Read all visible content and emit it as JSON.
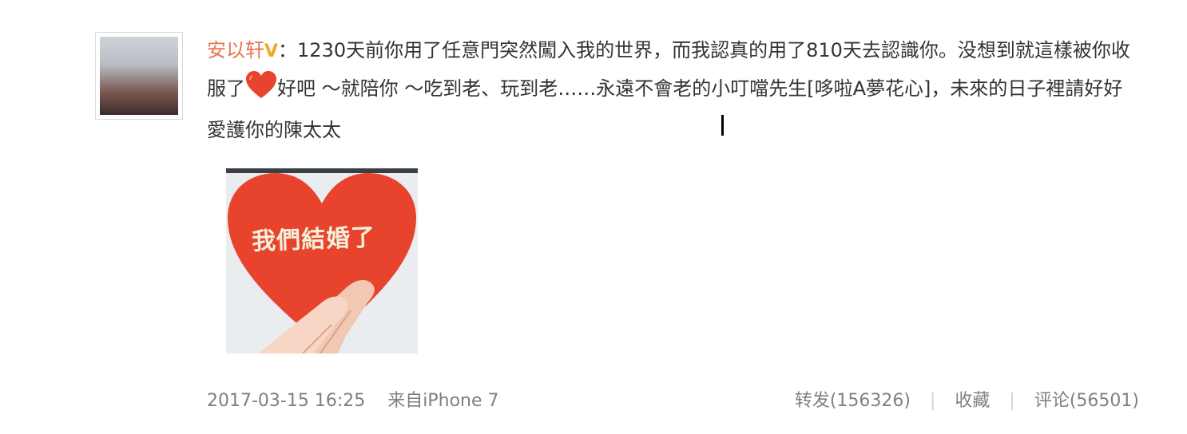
{
  "post": {
    "username": "安以轩",
    "vip_mark": "V",
    "colon": "：",
    "text_part1": "1230天前你用了任意門突然闖入我的世界，而我認真的用了810天去認識你。没想到就這樣被你收服了",
    "text_part2": "好吧 ～就陪你 ～吃到老、玩到老……永遠不會老的小叮噹先生[哆啦A夢花心]，未來的日子裡請好好愛護你的陳太太",
    "emoji_icon": "red-heart-emoji",
    "image_overlay_text": "我們結婚了",
    "timestamp": "2017-03-15 16:25",
    "source": "来自iPhone 7"
  },
  "actions": {
    "repost": "转发(156326)",
    "separator": "|",
    "favorite": "收藏",
    "comment": "评论(56501)"
  },
  "colors": {
    "username": "#eb7350",
    "vip": "#f5a623",
    "body_text": "#333333",
    "meta_text": "#808080",
    "heart": "#e8432c"
  }
}
